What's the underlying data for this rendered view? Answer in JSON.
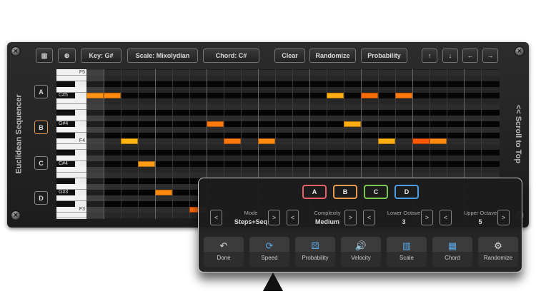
{
  "toolbar": {
    "key": "Key: G#",
    "scale": "Scale: Mixolydian",
    "chord": "Chord: C#",
    "clear": "Clear",
    "randomize": "Randomize",
    "probability": "Probability",
    "up": "↑",
    "down": "↓",
    "left": "←",
    "right": "→"
  },
  "side_title": "Euclidean Sequencer",
  "scroll_label": "<< Scroll to Top",
  "patterns": [
    "A",
    "B",
    "C",
    "D"
  ],
  "selected_pattern": "B",
  "keys": {
    "F5": "F5",
    "Cs5": "C#5",
    "Gs4": "G#4",
    "F4": "F4",
    "Cs4": "C#4",
    "Gs3": "G#3",
    "F3": "F3"
  },
  "sequence": {
    "steps": 24,
    "rows_from_F5": 26,
    "notes": [
      {
        "step": 0,
        "semi": 4,
        "color": "#ff9418"
      },
      {
        "step": 1,
        "semi": 4,
        "color": "#ff8a10"
      },
      {
        "step": 14,
        "semi": 4,
        "color": "#ffb010"
      },
      {
        "step": 16,
        "semi": 4,
        "color": "#ff6a0a"
      },
      {
        "step": 18,
        "semi": 4,
        "color": "#ff7a0c"
      },
      {
        "step": 7,
        "semi": 9,
        "color": "#ff7a0c"
      },
      {
        "step": 15,
        "semi": 9,
        "color": "#ffac10"
      },
      {
        "step": 2,
        "semi": 12,
        "color": "#ffb410"
      },
      {
        "step": 8,
        "semi": 12,
        "color": "#ff780c"
      },
      {
        "step": 10,
        "semi": 12,
        "color": "#ff8a10"
      },
      {
        "step": 17,
        "semi": 12,
        "color": "#ffb010"
      },
      {
        "step": 19,
        "semi": 12,
        "color": "#ff5a08"
      },
      {
        "step": 20,
        "semi": 12,
        "color": "#ff8a10"
      },
      {
        "step": 3,
        "semi": 16,
        "color": "#ff9a14"
      },
      {
        "step": 4,
        "semi": 21,
        "color": "#ff8a10"
      },
      {
        "step": 6,
        "semi": 24,
        "color": "#ff6a0a"
      }
    ]
  },
  "overlay": {
    "patterns": [
      {
        "label": "A",
        "color": "#e8606a"
      },
      {
        "label": "B",
        "color": "#e89a50"
      },
      {
        "label": "C",
        "color": "#7ac850"
      },
      {
        "label": "D",
        "color": "#4a9ee8"
      }
    ],
    "steppers": [
      {
        "label": "Mode",
        "value": "Steps+Seq"
      },
      {
        "label": "Complexity",
        "value": "Medium"
      },
      {
        "label": "Lower Octave",
        "value": "3"
      },
      {
        "label": "Upper Octave",
        "value": "5"
      }
    ],
    "prev": "<",
    "next": ">",
    "actions": [
      {
        "label": "Done",
        "icon": "↶"
      },
      {
        "label": "Speed",
        "icon": "⟳"
      },
      {
        "label": "Probability",
        "icon": "⚄"
      },
      {
        "label": "Velocity",
        "icon": "🔊"
      },
      {
        "label": "Scale",
        "icon": "▥"
      },
      {
        "label": "Chord",
        "icon": "▦"
      },
      {
        "label": "Randomize",
        "icon": "⚙"
      }
    ]
  }
}
